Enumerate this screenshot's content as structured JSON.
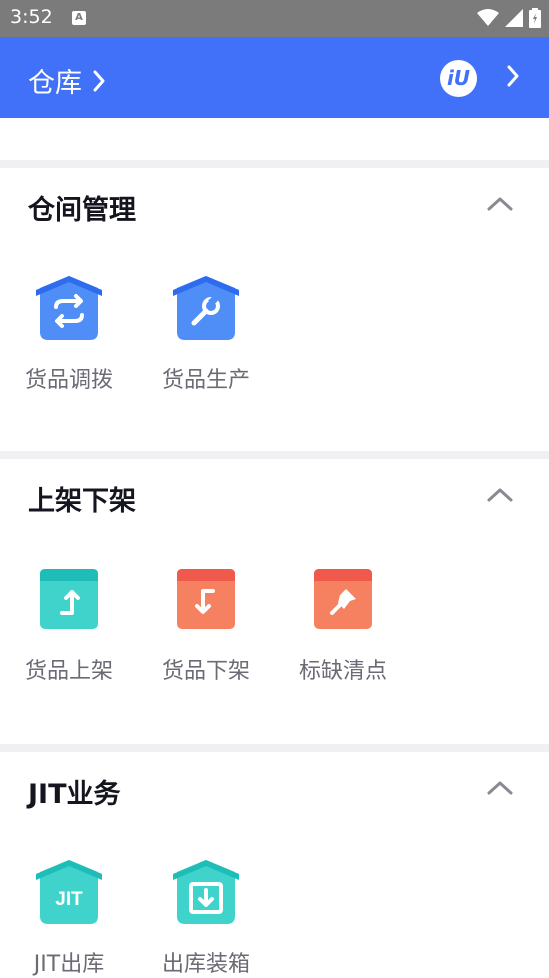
{
  "status_bar": {
    "time": "3:52",
    "notif": "A"
  },
  "app_bar": {
    "title": "仓库",
    "logo_text": "iU",
    "accent": "#4171f8"
  },
  "sections": [
    {
      "title": "仓间管理",
      "items": [
        {
          "label": "货品调拨",
          "icon": "transfer-icon"
        },
        {
          "label": "货品生产",
          "icon": "wrench-icon"
        }
      ]
    },
    {
      "title": "上架下架",
      "items": [
        {
          "label": "货品上架",
          "icon": "shelve-up-icon"
        },
        {
          "label": "货品下架",
          "icon": "shelve-down-icon"
        },
        {
          "label": "标缺清点",
          "icon": "pin-icon"
        }
      ]
    },
    {
      "title": "JIT业务",
      "items": [
        {
          "label": "JIT出库",
          "icon": "jit-icon",
          "icon_text": "JIT"
        },
        {
          "label": "出库装箱",
          "icon": "packing-icon"
        }
      ]
    }
  ]
}
